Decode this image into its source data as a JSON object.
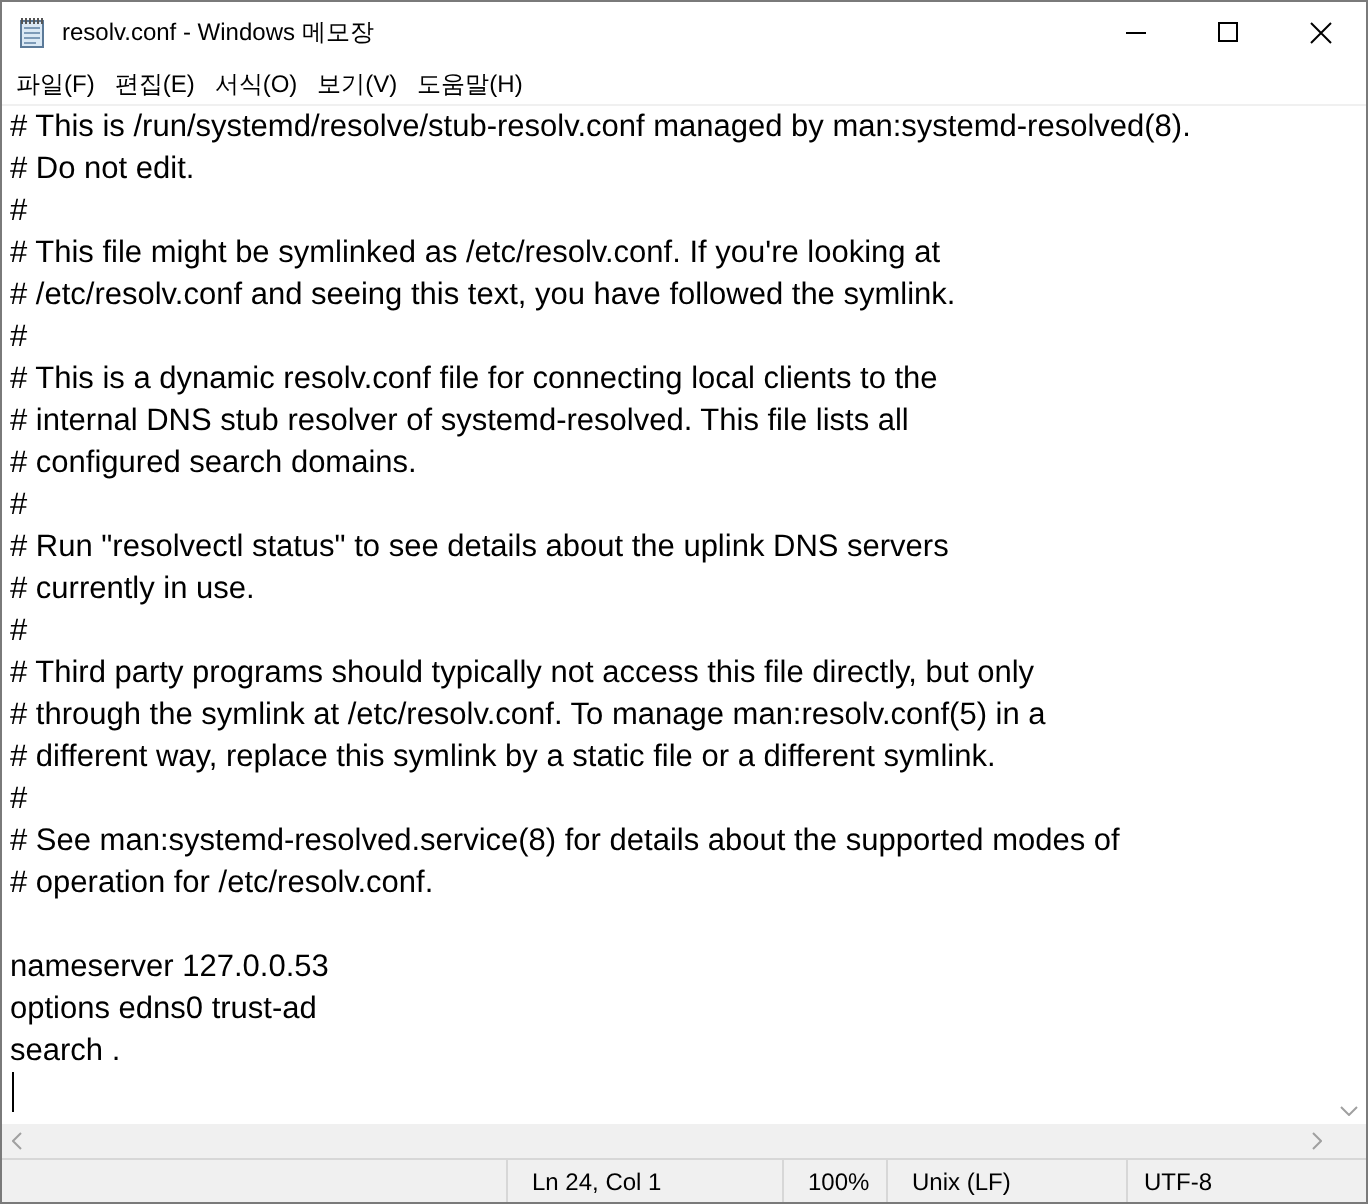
{
  "window": {
    "title": "resolv.conf - Windows 메모장"
  },
  "menu": [
    "파일(F)",
    "편집(E)",
    "서식(O)",
    "보기(V)",
    "도움말(H)"
  ],
  "editor": {
    "text": "# This is /run/systemd/resolve/stub-resolv.conf managed by man:systemd-resolved(8).\n# Do not edit.\n#\n# This file might be symlinked as /etc/resolv.conf. If you're looking at\n# /etc/resolv.conf and seeing this text, you have followed the symlink.\n#\n# This is a dynamic resolv.conf file for connecting local clients to the\n# internal DNS stub resolver of systemd-resolved. This file lists all\n# configured search domains.\n#\n# Run \"resolvectl status\" to see details about the uplink DNS servers\n# currently in use.\n#\n# Third party programs should typically not access this file directly, but only\n# through the symlink at /etc/resolv.conf. To manage man:resolv.conf(5) in a\n# different way, replace this symlink by a static file or a different symlink.\n#\n# See man:systemd-resolved.service(8) for details about the supported modes of\n# operation for /etc/resolv.conf.\n\nnameserver 127.0.0.53\noptions edns0 trust-ad\nsearch .\n"
  },
  "status_bar": [
    "Ln 24, Col 1",
    "100%",
    "Unix (LF)",
    "UTF-8"
  ]
}
